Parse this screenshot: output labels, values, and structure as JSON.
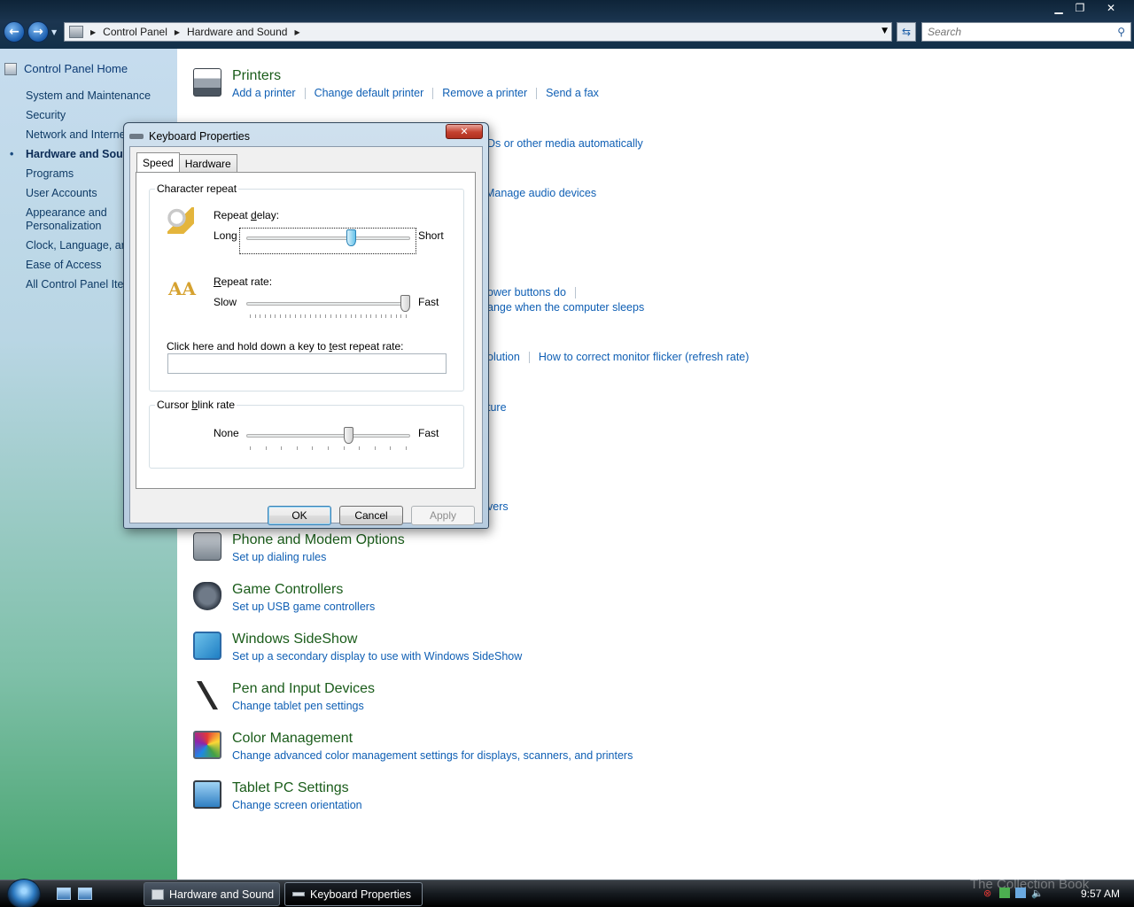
{
  "window": {
    "minimize_icon": "minimize-icon",
    "maximize_icon": "restore-icon",
    "close_icon": "close-icon"
  },
  "address_bar": {
    "crumbs": [
      "Control Panel",
      "Hardware and Sound"
    ],
    "search_placeholder": "Search"
  },
  "sidebar": {
    "home": "Control Panel Home",
    "items": [
      {
        "label": "System and Maintenance"
      },
      {
        "label": "Security"
      },
      {
        "label": "Network and Interne"
      },
      {
        "label": "Hardware and Soun",
        "active": true
      },
      {
        "label": "Programs"
      },
      {
        "label": "User Accounts"
      },
      {
        "label": "Appearance and Personalization"
      },
      {
        "label": "Clock, Language, an"
      },
      {
        "label": "Ease of Access"
      },
      {
        "label": "All Control Panel Iter"
      }
    ]
  },
  "main": {
    "printers": {
      "title": "Printers",
      "links": [
        "Add a printer",
        "Change default printer",
        "Remove a printer",
        "Send a fax"
      ]
    },
    "fragments": {
      "autoplay": "Ds or other media automatically",
      "sound": "Manage audio devices",
      "power_1": "ower buttons do",
      "power_2": "ange when the computer sleeps",
      "display_1": "olution",
      "display_2": "How to correct monitor flicker (refresh rate)",
      "personalize": "ture",
      "devmgr": "vers"
    },
    "categories": [
      {
        "title": "Phone and Modem Options",
        "link": "Set up dialing rules",
        "icon": "phone-modem-icon"
      },
      {
        "title": "Game Controllers",
        "link": "Set up USB game controllers",
        "icon": "game-controller-icon"
      },
      {
        "title": "Windows SideShow",
        "link": "Set up a secondary display to use with Windows SideShow",
        "icon": "sideshow-icon"
      },
      {
        "title": "Pen and Input Devices",
        "link": "Change tablet pen settings",
        "icon": "pen-icon"
      },
      {
        "title": "Color Management",
        "link": "Change advanced color management settings for displays, scanners, and printers",
        "icon": "color-management-icon"
      },
      {
        "title": "Tablet PC Settings",
        "link": "Change screen orientation",
        "icon": "tablet-pc-icon"
      }
    ]
  },
  "dialog": {
    "title": "Keyboard Properties",
    "close_label": "✕",
    "tabs": [
      "Speed",
      "Hardware"
    ],
    "char_repeat": {
      "legend": "Character repeat",
      "delay_label_pre": "Repeat ",
      "delay_label_key": "d",
      "delay_label_post": "elay:",
      "delay_left": "Long",
      "delay_right": "Short",
      "delay_value": 0.65,
      "rate_label_pre": "",
      "rate_label_key": "R",
      "rate_label_post": "epeat rate:",
      "rate_left": "Slow",
      "rate_right": "Fast",
      "rate_value": 1.0,
      "test_label_pre": "Click here and hold down a key to ",
      "test_label_key": "t",
      "test_label_post": "est repeat rate:",
      "test_value": ""
    },
    "cursor_blink": {
      "legend_pre": "Cursor ",
      "legend_key": "b",
      "legend_post": "link rate",
      "left": "None",
      "right": "Fast",
      "value": 0.63
    },
    "buttons": {
      "ok": "OK",
      "cancel": "Cancel",
      "apply": "Apply"
    }
  },
  "taskbar": {
    "buttons": [
      "Hardware and Sound",
      "Keyboard Properties"
    ],
    "clock": "9:57 AM",
    "watermark": "The Collection Book"
  }
}
